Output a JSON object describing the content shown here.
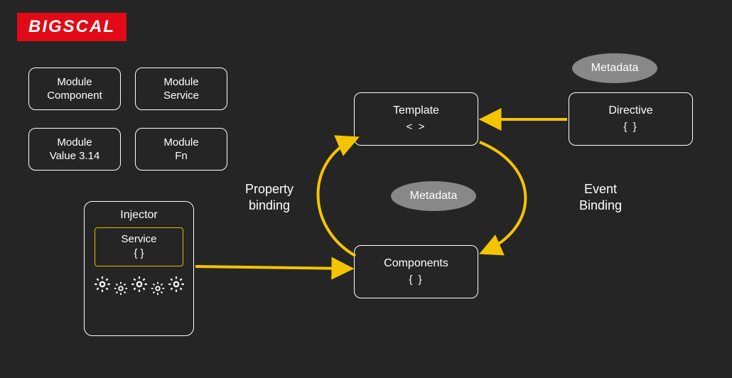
{
  "logo": "BIGSCAL",
  "modules": {
    "component": {
      "line1": "Module",
      "line2": "Component"
    },
    "service": {
      "line1": "Module",
      "line2": "Service"
    },
    "value": {
      "line1": "Module",
      "line2": "Value 3.14"
    },
    "fn": {
      "line1": "Module",
      "line2": "Fn"
    }
  },
  "injector": {
    "title": "Injector",
    "service_label": "Service",
    "service_braces": "{ }"
  },
  "template": {
    "title": "Template",
    "sub": "<  >"
  },
  "components": {
    "title": "Components",
    "sub": "{  }"
  },
  "directive": {
    "title": "Directive",
    "sub": "{  }"
  },
  "metadata1": "Metadata",
  "metadata2": "Metadata",
  "labels": {
    "property_binding_l1": "Property",
    "property_binding_l2": "binding",
    "event_binding_l1": "Event",
    "event_binding_l2": "Binding"
  },
  "colors": {
    "accent": "#f5c400",
    "logo_bg": "#e20a17"
  }
}
